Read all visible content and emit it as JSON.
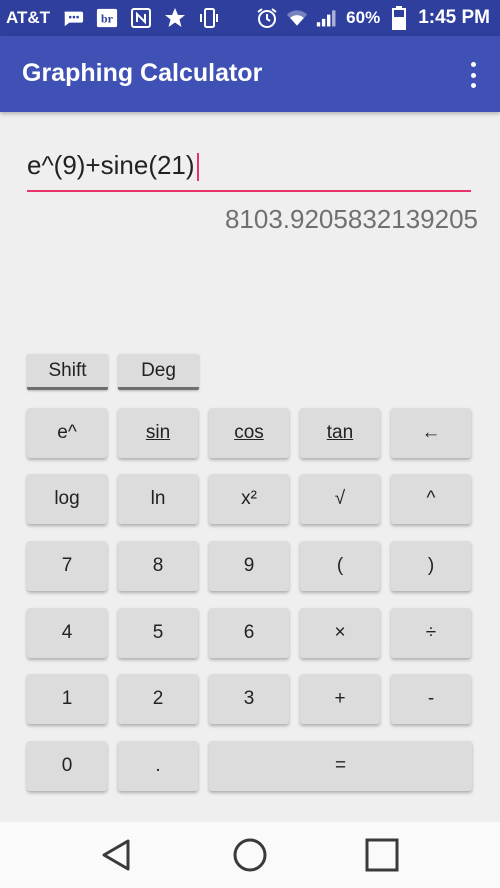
{
  "status_bar": {
    "carrier": "AT&T",
    "battery": "60%",
    "time": "1:45 PM",
    "icons": [
      "message-icon",
      "br-icon",
      "nfc-icon",
      "star-icon",
      "vibrate-icon",
      "alarm-icon",
      "wifi-icon",
      "signal-icon",
      "battery-icon"
    ]
  },
  "app_bar": {
    "title": "Graphing Calculator"
  },
  "input": {
    "expression": "e^(9)+sine(21)"
  },
  "result": "8103.9205832139205",
  "toggles": {
    "shift": "Shift",
    "deg": "Deg"
  },
  "keys": {
    "row1": [
      "e^",
      "sin",
      "cos",
      "tan",
      "←"
    ],
    "row2": [
      "log",
      "ln",
      "x²",
      "√",
      "^"
    ],
    "row3": [
      "7",
      "8",
      "9",
      "(",
      ")"
    ],
    "row4": [
      "4",
      "5",
      "6",
      "×",
      "÷"
    ],
    "row5": [
      "1",
      "2",
      "3",
      "+",
      "-"
    ],
    "row6": [
      "0",
      ".",
      "="
    ]
  },
  "accent_color": "#e8346b",
  "primary_color": "#3f51b5"
}
